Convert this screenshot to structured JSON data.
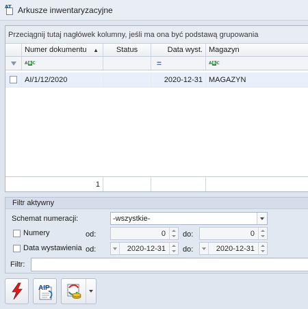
{
  "window": {
    "title": "Arkusze inwentaryzacyjne",
    "icon": "at-document-icon"
  },
  "grid": {
    "group_hint": "Przeciągnij tutaj nagłówek kolumny, jeśli ma ona być podstawą grupowania",
    "columns": [
      "Numer dokumentu",
      "Status",
      "Data wyst.",
      "Magazyn"
    ],
    "sort": {
      "column": "Numer dokumentu",
      "direction": "ascending"
    },
    "filter_icons": [
      "abc-filter-icon",
      "",
      "equals-filter-icon",
      "abc-filter-icon"
    ],
    "rows": [
      {
        "numer": "AI/1/12/2020",
        "status": "",
        "data": "2020-12-31",
        "magazyn": "MAGAZYN",
        "selected": true
      }
    ],
    "footer": {
      "count": "1"
    }
  },
  "filter_panel": {
    "title": "Filtr aktywny",
    "schemat_label": "Schemat numeracji:",
    "schemat_value": "-wszystkie-",
    "numery_label": "Numery",
    "od_label": "od:",
    "do_label": "do:",
    "numery_od": "0",
    "numery_do": "0",
    "data_label": "Data wystawienia",
    "data_od": "2020-12-31",
    "data_do": "2020-12-31",
    "filtr_label": "Filtr:",
    "filtr_value": ""
  },
  "toolbar": {
    "buttons": [
      "lightning-icon",
      "aip-document-icon",
      "coins-exchange-icon"
    ]
  },
  "colors": {
    "accent": "#1f4e8c",
    "selected_row": "#eaf0fb",
    "panel_bg": "#e1e8f1"
  }
}
